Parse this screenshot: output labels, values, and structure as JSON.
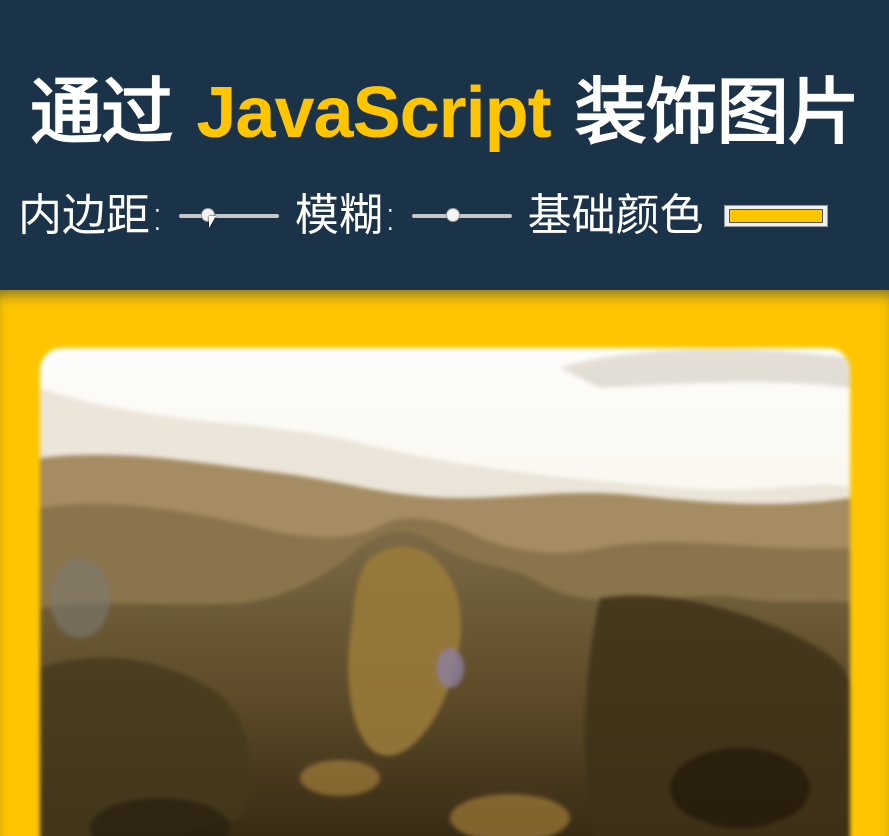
{
  "header": {
    "title_prefix": "通过",
    "title_accent": "JavaScript",
    "title_suffix": "装饰图片"
  },
  "controls": {
    "spacing": {
      "label": "内边距:",
      "value": 0.25
    },
    "blur": {
      "label": "模糊:",
      "value": 0.4
    },
    "base_color": {
      "label": "基础颜色",
      "value": "#ffc600"
    }
  },
  "colors": {
    "background": "#1b3349",
    "accent": "#ffc600",
    "text": "#ffffff"
  },
  "image": {
    "subject": "mountain-landscape-photo"
  }
}
